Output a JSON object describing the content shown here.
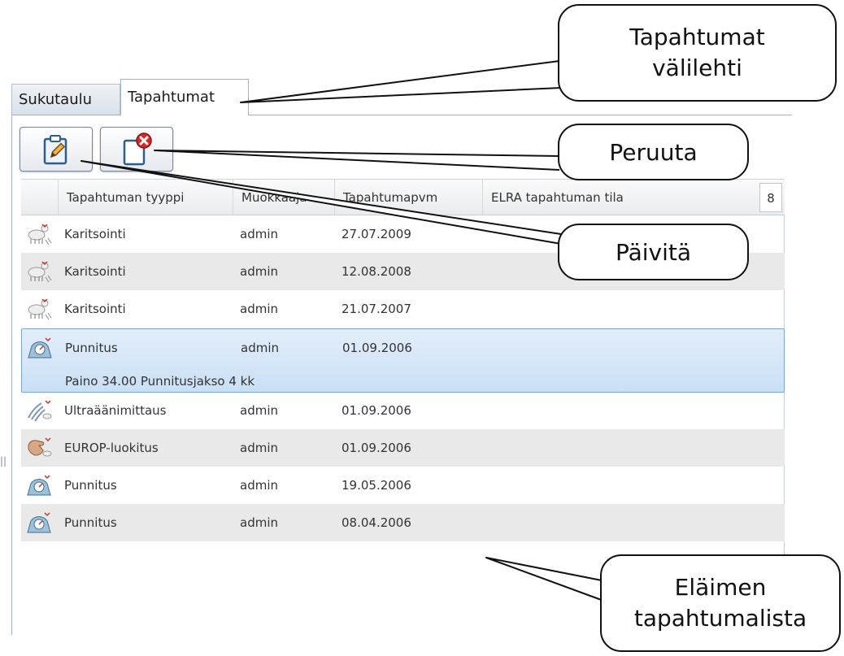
{
  "tabs": [
    {
      "label": "Sukutaulu",
      "active": false
    },
    {
      "label": "Tapahtumat",
      "active": true
    }
  ],
  "toolbar": {
    "update_icon": "clipboard-pencil-icon",
    "cancel_icon": "clipboard-cancel-icon"
  },
  "grid": {
    "columns": [
      "Tapahtuman tyyppi",
      "Muokkaaja",
      "Tapahtumapvm",
      "ELRA tapahtuman tila"
    ],
    "count": "8",
    "rows": [
      {
        "icon": "sheep-lambing-icon",
        "type": "Karitsointi",
        "editor": "admin",
        "date": "27.07.2009"
      },
      {
        "icon": "sheep-lambing-icon",
        "type": "Karitsointi",
        "editor": "admin",
        "date": "12.08.2008"
      },
      {
        "icon": "sheep-lambing-icon",
        "type": "Karitsointi",
        "editor": "admin",
        "date": "21.07.2007"
      },
      {
        "icon": "scale-weighing-icon",
        "type": "Punnitus",
        "editor": "admin",
        "date": "01.09.2006",
        "detail": "Paino 34.00 Punnitusjakso 4 kk",
        "selected": true
      },
      {
        "icon": "ultrasound-icon",
        "type": "Ultraäänimittaus",
        "editor": "admin",
        "date": "01.09.2006"
      },
      {
        "icon": "hand-classification-icon",
        "type": "EUROP-luokitus",
        "editor": "admin",
        "date": "01.09.2006"
      },
      {
        "icon": "scale-weighing-icon",
        "type": "Punnitus",
        "editor": "admin",
        "date": "19.05.2006"
      },
      {
        "icon": "scale-weighing-icon",
        "type": "Punnitus",
        "editor": "admin",
        "date": "08.04.2006"
      }
    ]
  },
  "callouts": {
    "tab": [
      "Tapahtumat",
      "välilehti"
    ],
    "cancel": "Peruuta",
    "update": "Päivitä",
    "list": [
      "Eläimen",
      "tapahtumalista"
    ]
  },
  "left_edge_mark": "||",
  "colors": {
    "selected_row": "#cadff5",
    "alt_row": "#e9e9e9",
    "tab_border": "#9fb2c6"
  }
}
